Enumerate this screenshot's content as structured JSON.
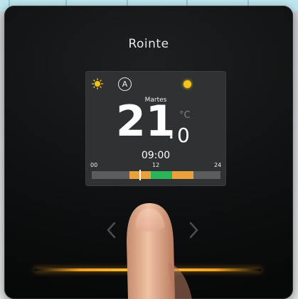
{
  "device": {
    "brand": "Rointe"
  },
  "screen": {
    "mode_label": "A",
    "day": "Martes",
    "temperature_integer": "21",
    "temperature_separator": ".",
    "temperature_decimal": "0",
    "unit": "°C",
    "time": "09:00",
    "timeline": {
      "ticks": [
        "00",
        "12",
        "24"
      ],
      "current_hour": 9,
      "segments": [
        {
          "from_hour": 0,
          "to_hour": 7,
          "color": "#5a5c5e"
        },
        {
          "from_hour": 7,
          "to_hour": 11,
          "color": "#e9a23b"
        },
        {
          "from_hour": 11,
          "to_hour": 15,
          "color": "#2bb35a"
        },
        {
          "from_hour": 15,
          "to_hour": 19,
          "color": "#e9a23b"
        },
        {
          "from_hour": 19,
          "to_hour": 24,
          "color": "#5a5c5e"
        }
      ]
    },
    "colors": {
      "accent": "#f4c21b",
      "comfort": "#e9a23b",
      "eco": "#2bb35a"
    }
  },
  "icons": {
    "sun": "sun-icon",
    "auto": "auto-mode-icon",
    "status": "status-dot-icon",
    "left": "chevron-left-icon",
    "right": "chevron-right-icon"
  }
}
